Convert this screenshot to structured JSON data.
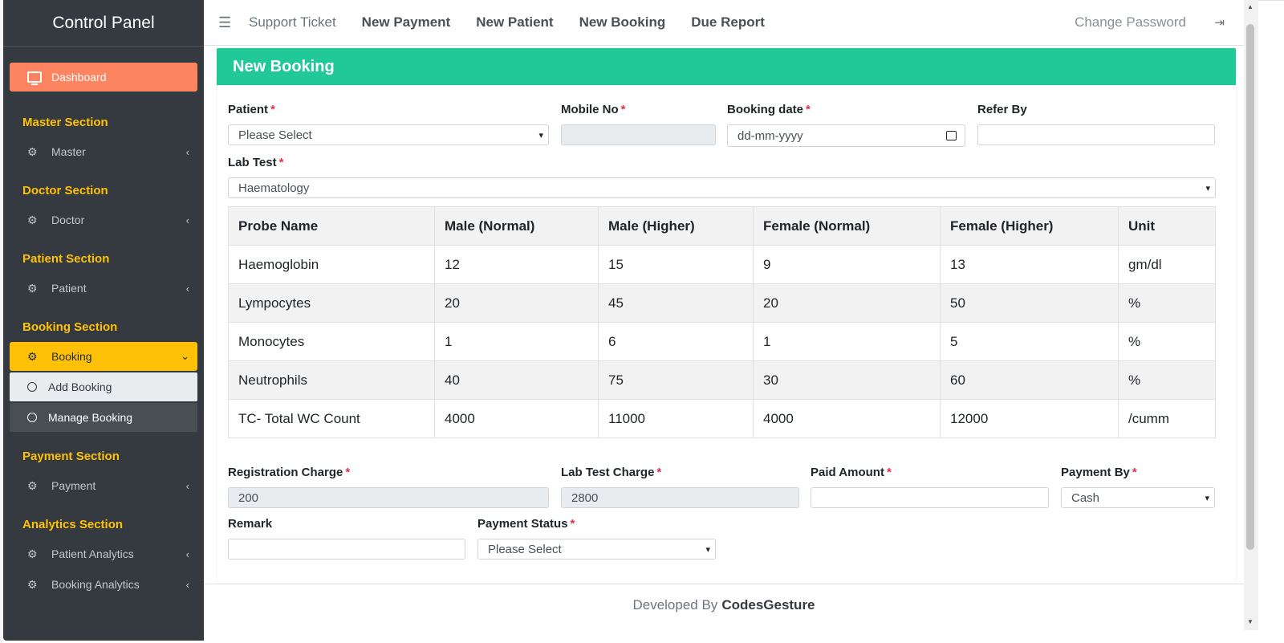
{
  "sidebar": {
    "brand": "Control Panel",
    "dashboard": "Dashboard",
    "sections": [
      {
        "title": "Master Section",
        "item": "Master"
      },
      {
        "title": "Doctor Section",
        "item": "Doctor"
      },
      {
        "title": "Patient Section",
        "item": "Patient"
      },
      {
        "title": "Booking Section",
        "item": "Booking",
        "subs": [
          "Add Booking",
          "Manage Booking"
        ]
      },
      {
        "title": "Payment Section",
        "item": "Payment"
      },
      {
        "title": "Analytics Section",
        "items": [
          "Patient Analytics",
          "Booking Analytics"
        ]
      }
    ]
  },
  "topnav": {
    "links": [
      "Support Ticket",
      "New Payment",
      "New Patient",
      "New Booking",
      "Due Report"
    ],
    "change_password": "Change Password"
  },
  "form": {
    "title": "New Booking",
    "patient_label": "Patient",
    "patient_value": "Please Select",
    "mobile_label": "Mobile No",
    "mobile_value": "",
    "booking_date_label": "Booking date",
    "booking_date_placeholder": "dd-mm-yyyy",
    "refer_label": "Refer By",
    "lab_test_label": "Lab Test",
    "lab_test_value": "Haematology",
    "table": {
      "headers": [
        "Probe Name",
        "Male (Normal)",
        "Male (Higher)",
        "Female (Normal)",
        "Female (Higher)",
        "Unit"
      ],
      "rows": [
        [
          "Haemoglobin",
          "12",
          "15",
          "9",
          "13",
          "gm/dl"
        ],
        [
          "Lympocytes",
          "20",
          "45",
          "20",
          "50",
          "%"
        ],
        [
          "Monocytes",
          "1",
          "6",
          "1",
          "5",
          "%"
        ],
        [
          "Neutrophils",
          "40",
          "75",
          "30",
          "60",
          "%"
        ],
        [
          "TC- Total WC Count",
          "4000",
          "11000",
          "4000",
          "12000",
          "/cumm"
        ]
      ]
    },
    "reg_charge_label": "Registration Charge",
    "reg_charge_value": "200",
    "lab_charge_label": "Lab Test Charge",
    "lab_charge_value": "2800",
    "paid_label": "Paid Amount",
    "payment_by_label": "Payment By",
    "payment_by_value": "Cash",
    "remark_label": "Remark",
    "status_label": "Payment Status",
    "status_value": "Please Select"
  },
  "footer": {
    "prefix": "Developed By",
    "brand": "CodesGesture"
  },
  "colors": {
    "sidebar": "#343a40",
    "dashboard": "#fd8461",
    "active": "#ffc107",
    "header": "#20c997"
  }
}
